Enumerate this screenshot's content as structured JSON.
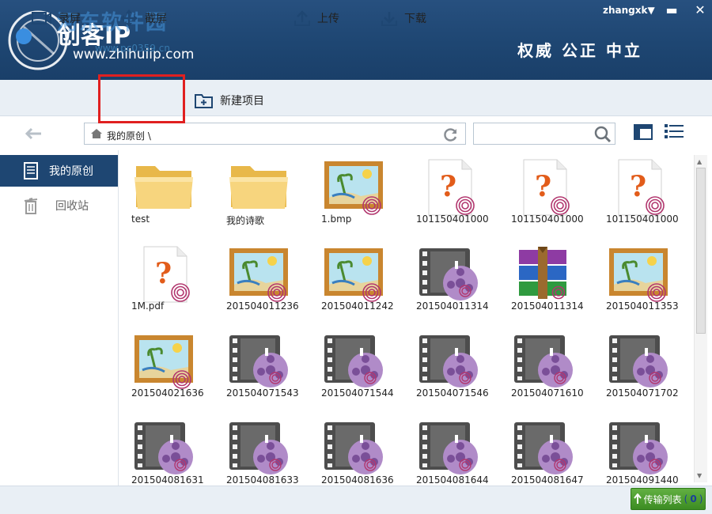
{
  "header": {
    "brand": "创客IP",
    "url": "www.zhihuiip.com",
    "watermark": "河东软件园",
    "watermark_url": "www.pc0359.cn",
    "slogan": "权威  公正  中立",
    "user": "zhangxk▼",
    "win_minimize": "▬",
    "win_close": "✕"
  },
  "toolbar": {
    "record": "录屏",
    "screenshot": "截屏",
    "new_project": "新建项目",
    "upload": "上传",
    "download": "下载"
  },
  "nav": {
    "path": "我的原创 \\",
    "search_placeholder": ""
  },
  "sidebar": {
    "items": [
      {
        "label": "我的原创",
        "active": true
      },
      {
        "label": "回收站",
        "active": false
      }
    ]
  },
  "files": [
    {
      "name": "test",
      "type": "folder"
    },
    {
      "name": "我的诗歌",
      "type": "folder"
    },
    {
      "name": "1.bmp",
      "type": "image"
    },
    {
      "name": "101150401000",
      "type": "unknown"
    },
    {
      "name": "101150401000",
      "type": "unknown"
    },
    {
      "name": "101150401000",
      "type": "unknown"
    },
    {
      "name": "1M.pdf",
      "type": "unknown"
    },
    {
      "name": "201504011236",
      "type": "image"
    },
    {
      "name": "201504011242",
      "type": "image"
    },
    {
      "name": "201504011314",
      "type": "video"
    },
    {
      "name": "201504011314",
      "type": "archive"
    },
    {
      "name": "201504011353",
      "type": "image"
    },
    {
      "name": "201504021636",
      "type": "image"
    },
    {
      "name": "201504071543",
      "type": "video"
    },
    {
      "name": "201504071544",
      "type": "video"
    },
    {
      "name": "201504071546",
      "type": "video"
    },
    {
      "name": "201504071610",
      "type": "video"
    },
    {
      "name": "201504071702",
      "type": "video"
    },
    {
      "name": "201504081631",
      "type": "video"
    },
    {
      "name": "201504081633",
      "type": "video"
    },
    {
      "name": "201504081636",
      "type": "video"
    },
    {
      "name": "201504081644",
      "type": "video"
    },
    {
      "name": "201504081647",
      "type": "video"
    },
    {
      "name": "201504091440",
      "type": "video"
    }
  ],
  "status": {
    "transfer_label": "传输列表",
    "transfer_count": "0"
  },
  "colors": {
    "header": "#1e4672",
    "accent_red": "#e02020",
    "green": "#3c8c22",
    "purple": "#9a6bb5"
  }
}
